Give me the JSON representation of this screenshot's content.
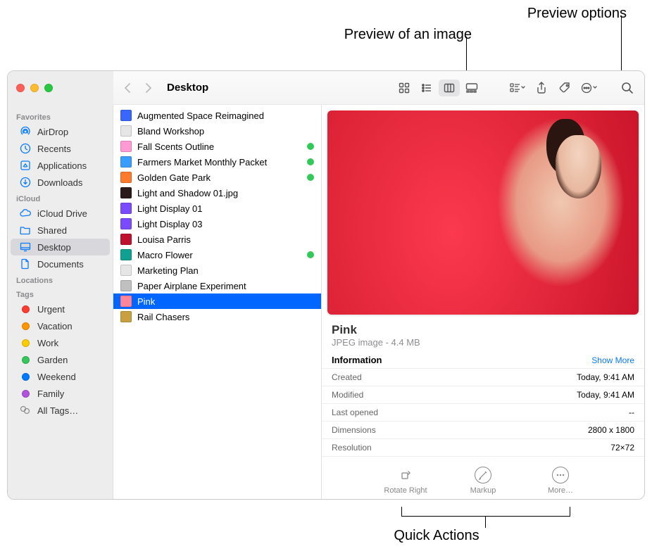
{
  "callouts": {
    "preview_image": "Preview of an image",
    "preview_options": "Preview options",
    "quick_actions": "Quick Actions"
  },
  "toolbar": {
    "title": "Desktop"
  },
  "sidebar": {
    "sections": [
      {
        "header": "Favorites",
        "items": [
          {
            "label": "AirDrop",
            "icon": "airdrop"
          },
          {
            "label": "Recents",
            "icon": "clock"
          },
          {
            "label": "Applications",
            "icon": "apps"
          },
          {
            "label": "Downloads",
            "icon": "download"
          }
        ]
      },
      {
        "header": "iCloud",
        "items": [
          {
            "label": "iCloud Drive",
            "icon": "cloud"
          },
          {
            "label": "Shared",
            "icon": "folder"
          },
          {
            "label": "Desktop",
            "icon": "desktop",
            "selected": true
          },
          {
            "label": "Documents",
            "icon": "doc"
          }
        ]
      },
      {
        "header": "Locations",
        "items": []
      },
      {
        "header": "Tags",
        "items": [
          {
            "label": "Urgent",
            "color": "#ff3b30"
          },
          {
            "label": "Vacation",
            "color": "#ff9500"
          },
          {
            "label": "Work",
            "color": "#ffcc00"
          },
          {
            "label": "Garden",
            "color": "#34c759"
          },
          {
            "label": "Weekend",
            "color": "#007aff"
          },
          {
            "label": "Family",
            "color": "#af52de"
          },
          {
            "label": "All Tags…",
            "icon": "alltags"
          }
        ]
      }
    ]
  },
  "files": [
    {
      "name": "Augmented Space Reimagined",
      "kind": "slides-blue"
    },
    {
      "name": "Bland Workshop",
      "kind": "doc"
    },
    {
      "name": "Fall Scents Outline",
      "kind": "slides-pink",
      "tag": "#34c759"
    },
    {
      "name": "Farmers Market Monthly Packet",
      "kind": "doc-blue",
      "tag": "#34c759"
    },
    {
      "name": "Golden Gate Park",
      "kind": "image-orange",
      "tag": "#34c759"
    },
    {
      "name": "Light and Shadow 01.jpg",
      "kind": "image-dark"
    },
    {
      "name": "Light Display 01",
      "kind": "image-purple"
    },
    {
      "name": "Light Display 03",
      "kind": "image-purple"
    },
    {
      "name": "Louisa Parris",
      "kind": "image-red"
    },
    {
      "name": "Macro Flower",
      "kind": "image-teal",
      "tag": "#34c759"
    },
    {
      "name": "Marketing Plan",
      "kind": "doc"
    },
    {
      "name": "Paper Airplane Experiment",
      "kind": "doc-gray"
    },
    {
      "name": "Pink",
      "kind": "image-pink",
      "selected": true
    },
    {
      "name": "Rail Chasers",
      "kind": "image-gold"
    }
  ],
  "preview": {
    "title": "Pink",
    "subtitle": "JPEG image - 4.4 MB",
    "info_header": "Information",
    "show_more": "Show More",
    "rows": [
      {
        "label": "Created",
        "value": "Today, 9:41 AM"
      },
      {
        "label": "Modified",
        "value": "Today, 9:41 AM"
      },
      {
        "label": "Last opened",
        "value": "--"
      },
      {
        "label": "Dimensions",
        "value": "2800 x 1800"
      },
      {
        "label": "Resolution",
        "value": "72×72"
      }
    ],
    "quick_actions": [
      {
        "label": "Rotate Right"
      },
      {
        "label": "Markup"
      },
      {
        "label": "More…"
      }
    ]
  }
}
